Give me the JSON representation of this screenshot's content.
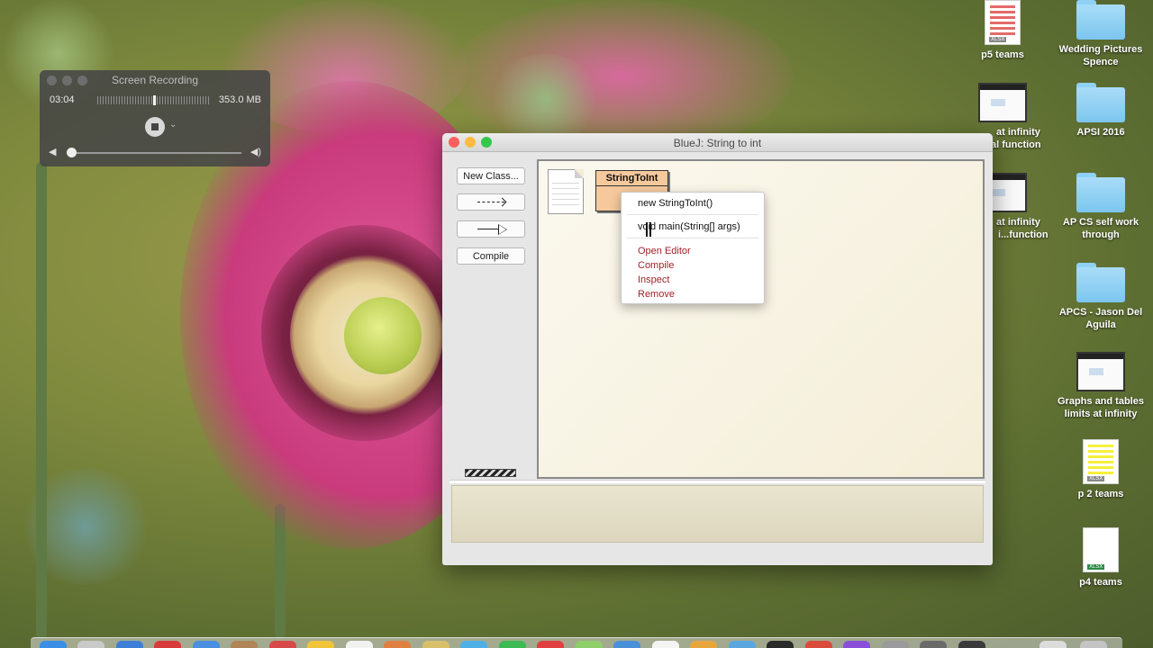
{
  "recorder": {
    "title": "Screen Recording",
    "elapsed": "03:04",
    "file_size": "353.0 MB"
  },
  "desktop_items": [
    {
      "label": "p5 teams",
      "icon": "xlsx-file-icon"
    },
    {
      "label": "Wedding Pictures Spence",
      "icon": "folder-icon"
    },
    {
      "label": "at infinity",
      "icon": "screenshot-thumbnail-icon"
    },
    {
      "label": "al function",
      "icon": "screenshot-thumbnail-icon"
    },
    {
      "label": "APSI 2016",
      "icon": "folder-icon"
    },
    {
      "label": "at infinity",
      "icon": "screenshot-thumbnail-icon"
    },
    {
      "label": "i...function",
      "icon": "screenshot-thumbnail-icon"
    },
    {
      "label": "AP CS self work through",
      "icon": "folder-icon"
    },
    {
      "label": "APCS - Jason Del Aguila",
      "icon": "folder-icon"
    },
    {
      "label": "Graphs and tables limits at infinity",
      "icon": "screenshot-thumbnail-icon"
    },
    {
      "label": "p 2 teams",
      "icon": "xlsx-file-icon"
    },
    {
      "label": "p4 teams",
      "icon": "xlsx-file-icon"
    }
  ],
  "xlsx_tag": "XLSX",
  "bluej": {
    "window_title": "BlueJ:  String to int",
    "buttons": {
      "new_class": "New Class...",
      "compile": "Compile"
    },
    "class_name": "StringToInt",
    "context_menu": {
      "constructor": "new StringToInt()",
      "main": "void main(String[] args)",
      "open_editor": "Open Editor",
      "compile": "Compile",
      "inspect": "Inspect",
      "remove": "Remove"
    }
  },
  "colors": {
    "menu_action_red": "#a0242a",
    "class_fill": "#f6c99d",
    "traffic_red": "#fc605c",
    "traffic_yellow": "#fdbc40",
    "traffic_green": "#34c84a"
  }
}
